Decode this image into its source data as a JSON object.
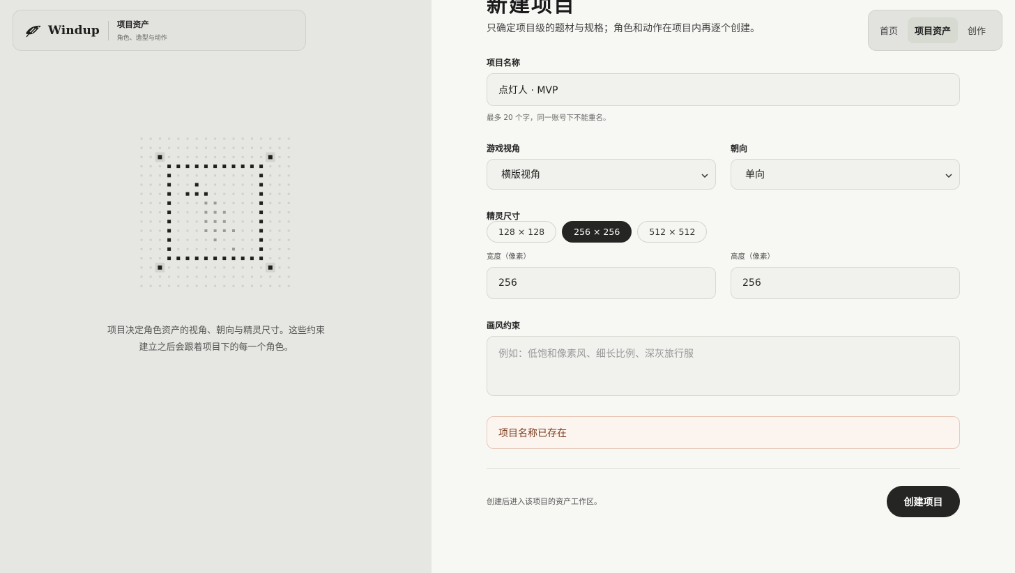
{
  "brand": {
    "name": "Windup",
    "section_title": "项目资产",
    "section_sub": "角色、造型与动作"
  },
  "left_caption": {
    "line1": "项目决定角色资产的视角、朝向与精灵尺寸。这些约束",
    "line2": "建立之后会跟着项目下的每一个角色。"
  },
  "nav": {
    "items": [
      {
        "label": "首页",
        "active": false
      },
      {
        "label": "项目资产",
        "active": true
      },
      {
        "label": "创作",
        "active": false
      }
    ]
  },
  "header": {
    "title": "新建项目",
    "subtitle": "只确定项目级的题材与规格；角色和动作在项目内再逐个创建。"
  },
  "form": {
    "name_label": "项目名称",
    "name_value": "点灯人 · MVP",
    "name_hint": "最多 20 个字，同一账号下不能重名。",
    "perspective_label": "游戏视角",
    "perspective_value": "横版视角",
    "orientation_label": "朝向",
    "orientation_value": "单向",
    "sprite_label": "精灵尺寸",
    "sprite_options": [
      "128 × 128",
      "256 × 256",
      "512 × 512"
    ],
    "sprite_selected_index": 1,
    "width_label": "宽度（像素）",
    "width_value": "256",
    "height_label": "高度（像素）",
    "height_value": "256",
    "style_label": "画风约束",
    "style_placeholder": "例如：低饱和像素风、细长比例、深灰旅行服",
    "error_text": "项目名称已存在",
    "footer_note": "创建后进入该项目的资产工作区。",
    "submit_label": "创建项目"
  },
  "icons": {
    "logo": "bird-icon",
    "select_arrow": "chevron-down-icon"
  },
  "colors": {
    "accent_dark": "#252523",
    "left_panel_bg": "#e6e7e2",
    "error_bg": "#fcf4ee",
    "error_text": "#7a3b1e"
  }
}
